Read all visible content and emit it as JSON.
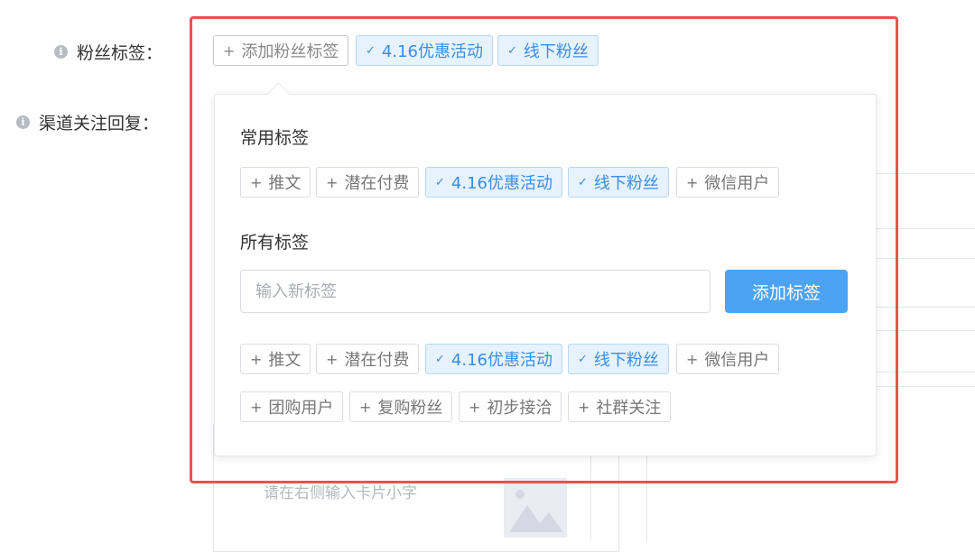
{
  "form": {
    "fan_tags_label": "粉丝标签：",
    "channel_reply_label": "渠道关注回复：",
    "add_tag_button": "添加粉丝标签",
    "selected_tags": [
      "4.16优惠活动",
      "线下粉丝"
    ],
    "card_hint": "请在右侧输入卡片小字"
  },
  "popover": {
    "common_title": "常用标签",
    "common_tags": [
      {
        "label": "推文",
        "selected": false
      },
      {
        "label": "潜在付费",
        "selected": false
      },
      {
        "label": "4.16优惠活动",
        "selected": true
      },
      {
        "label": "线下粉丝",
        "selected": true
      },
      {
        "label": "微信用户",
        "selected": false
      }
    ],
    "all_title": "所有标签",
    "new_tag_placeholder": "输入新标签",
    "add_button": "添加标签",
    "all_tags_row1": [
      {
        "label": "推文",
        "selected": false
      },
      {
        "label": "潜在付费",
        "selected": false
      },
      {
        "label": "4.16优惠活动",
        "selected": true
      },
      {
        "label": "线下粉丝",
        "selected": true
      },
      {
        "label": "微信用户",
        "selected": false
      }
    ],
    "all_tags_row2": [
      {
        "label": "团购用户",
        "selected": false
      },
      {
        "label": "复购粉丝",
        "selected": false
      },
      {
        "label": "初步接洽",
        "selected": false
      },
      {
        "label": "社群关注",
        "selected": false
      }
    ]
  },
  "icons": {
    "info": "info-icon",
    "plus": "plus-icon",
    "check": "check-icon",
    "image": "image-placeholder-icon"
  },
  "colors": {
    "accent": "#4da3f3",
    "selected_text": "#3a8ee6",
    "selected_bg": "#e6f2fd",
    "highlight_border": "#e8524d"
  }
}
